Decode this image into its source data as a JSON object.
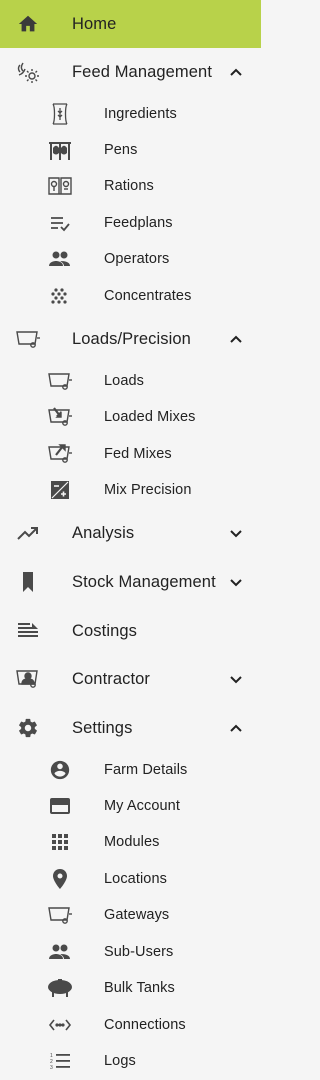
{
  "colors": {
    "home_bg": "#b8d24a",
    "sidebar_bg": "#f5f5f5",
    "icon": "#4a4a4a",
    "text": "#222222"
  },
  "nav": {
    "home": {
      "label": "Home",
      "icon": "home-icon"
    },
    "feed_management": {
      "label": "Feed Management",
      "icon": "gear-wheat-icon",
      "expanded": true,
      "items": [
        {
          "label": "Ingredients",
          "icon": "ingredient-sack-icon"
        },
        {
          "label": "Pens",
          "icon": "cattle-pen-icon"
        },
        {
          "label": "Rations",
          "icon": "rations-book-icon"
        },
        {
          "label": "Feedplans",
          "icon": "checklist-icon"
        },
        {
          "label": "Operators",
          "icon": "people-icon"
        },
        {
          "label": "Concentrates",
          "icon": "dots-grid-icon"
        }
      ]
    },
    "loads_precision": {
      "label": "Loads/Precision",
      "icon": "feeder-wagon-icon",
      "expanded": true,
      "items": [
        {
          "label": "Loads",
          "icon": "wagon-icon"
        },
        {
          "label": "Loaded Mixes",
          "icon": "wagon-down-arrow-icon"
        },
        {
          "label": "Fed Mixes",
          "icon": "wagon-up-arrow-icon"
        },
        {
          "label": "Mix Precision",
          "icon": "plus-minus-box-icon"
        }
      ]
    },
    "analysis": {
      "label": "Analysis",
      "icon": "trending-up-icon",
      "expanded": false
    },
    "stock_management": {
      "label": "Stock Management",
      "icon": "bookmark-icon",
      "expanded": false
    },
    "costings": {
      "label": "Costings",
      "icon": "costings-list-icon"
    },
    "contractor": {
      "label": "Contractor",
      "icon": "contractor-wagon-icon",
      "expanded": false
    },
    "settings": {
      "label": "Settings",
      "icon": "settings-gear-icon",
      "expanded": true,
      "items": [
        {
          "label": "Farm Details",
          "icon": "account-circle-icon"
        },
        {
          "label": "My Account",
          "icon": "credit-card-icon"
        },
        {
          "label": "Modules",
          "icon": "apps-grid-icon"
        },
        {
          "label": "Locations",
          "icon": "location-pin-icon"
        },
        {
          "label": "Gateways",
          "icon": "gateway-wagon-icon"
        },
        {
          "label": "Sub-Users",
          "icon": "sub-users-icon"
        },
        {
          "label": "Bulk Tanks",
          "icon": "bulk-tank-icon"
        },
        {
          "label": "Connections",
          "icon": "connections-arrows-icon"
        },
        {
          "label": "Logs",
          "icon": "numbered-list-icon"
        }
      ]
    }
  }
}
